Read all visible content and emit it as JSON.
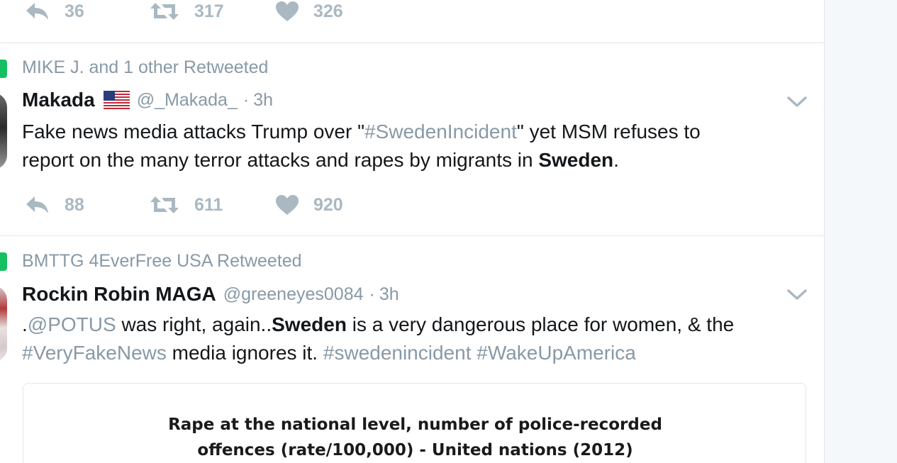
{
  "tweets": [
    {
      "actions": {
        "replies": "36",
        "retweets": "317",
        "likes": "326"
      }
    },
    {
      "retweet_context": "MIKE J. and 1 other Retweeted",
      "fullname": "Makada",
      "handle": "@_Makada_",
      "sep": "·",
      "time": "3h",
      "text": {
        "p1": "Fake news media attacks Trump over \"",
        "hashtag1": "#SwedenIncident",
        "p2": "\" yet MSM refuses to",
        "p3": "report on the many terror attacks and rapes by migrants in ",
        "bold1": "Sweden",
        "p4": "."
      },
      "actions": {
        "replies": "88",
        "retweets": "611",
        "likes": "920"
      }
    },
    {
      "retweet_context": "BMTTG 4EverFree USA Retweeted",
      "fullname": "Rockin Robin MAGA",
      "handle": "@greeneyes0084",
      "sep": "·",
      "time": "3h",
      "text": {
        "p1": ".",
        "mention1": "@POTUS",
        "p2": " was right, again..",
        "bold1": "Sweden",
        "p3": " is a very dangerous place for women, & the",
        "hashtag1": "#VeryFakeNews",
        "p4": " media ignores it. ",
        "hashtag2": "#swedenincident",
        "p5": " ",
        "hashtag3": "#WakeUpAmerica"
      },
      "card": {
        "title_line1": "Rape at the national level, number of police-recorded",
        "title_line2": "offences (rate/100,000) - United nations (2012)"
      }
    }
  ],
  "icons": {
    "reply": "reply-icon",
    "retweet": "retweet-icon",
    "like": "heart-icon",
    "caret": "chevron-down-icon",
    "flag": "us-flag-icon"
  },
  "colors": {
    "action_gray": "#aab8c2",
    "meta_gray": "#8899a6",
    "retweet_green": "#17bf63",
    "text": "#14171a",
    "border": "#e1e8ed"
  }
}
